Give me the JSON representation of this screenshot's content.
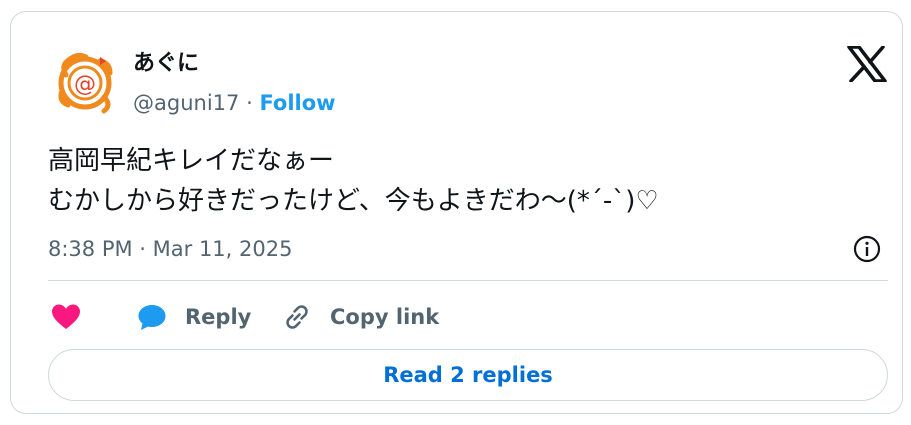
{
  "author": {
    "display_name": "あぐに",
    "handle": "@aguni17",
    "separator": "·",
    "follow_label": "Follow",
    "avatar_icon": "orange-swirl-avatar"
  },
  "tweet": {
    "text": "高岡早紀キレイだなぁー\nむかしから好きだったけど、今もよきだわ〜(*´-`)♡",
    "timestamp": "8:38 PM · Mar 11, 2025"
  },
  "actions": {
    "like_icon": "heart-icon",
    "reply_label": "Reply",
    "copy_label": "Copy link",
    "read_replies_label": "Read 2 replies"
  },
  "colors": {
    "accent": "#1d9bf0",
    "like": "#f91880",
    "link": "#006fd6",
    "muted": "#536471",
    "border": "#cfd9de"
  }
}
